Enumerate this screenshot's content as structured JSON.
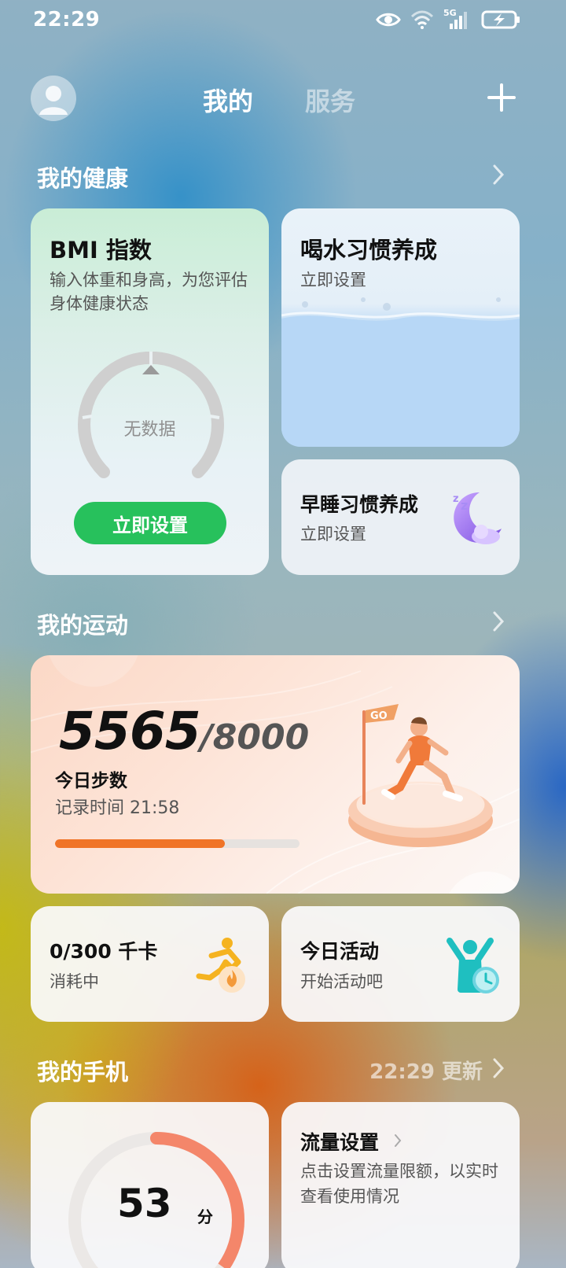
{
  "status_bar": {
    "time": "22:29",
    "network": "5G",
    "icons": [
      "eye-icon",
      "wifi-icon",
      "signal-icon",
      "battery-charging-icon"
    ]
  },
  "header": {
    "tabs": [
      {
        "label": "我的",
        "active": true
      },
      {
        "label": "服务",
        "active": false
      }
    ],
    "add_icon": "plus-icon"
  },
  "health": {
    "section_title": "我的健康",
    "bmi": {
      "title": "BMI 指数",
      "subtitle": "输入体重和身高，为您评估身体健康状态",
      "gauge_text": "无数据",
      "button": "立即设置"
    },
    "water": {
      "title": "喝水习惯养成",
      "subtitle": "立即设置"
    },
    "sleep": {
      "title": "早睡习惯养成",
      "subtitle": "立即设置"
    }
  },
  "sport": {
    "section_title": "我的运动",
    "steps": {
      "current": "5565",
      "goal": "/8000",
      "label": "今日步数",
      "record_time": "记录时间 21:58",
      "progress": 0.6956,
      "progress_color": "#f07427"
    },
    "calories": {
      "title": "0/300 千卡",
      "subtitle": "消耗中"
    },
    "activity": {
      "title": "今日活动",
      "subtitle": "开始活动吧"
    }
  },
  "phone": {
    "section_title": "我的手机",
    "updated": "22:29 更新",
    "score": {
      "value": "53",
      "unit": "分"
    },
    "flow": {
      "title": "流量设置",
      "subtitle": "点击设置流量限额，以实时查看使用情况"
    }
  },
  "colors": {
    "accent_green": "#27c15c",
    "accent_orange": "#f07427"
  }
}
